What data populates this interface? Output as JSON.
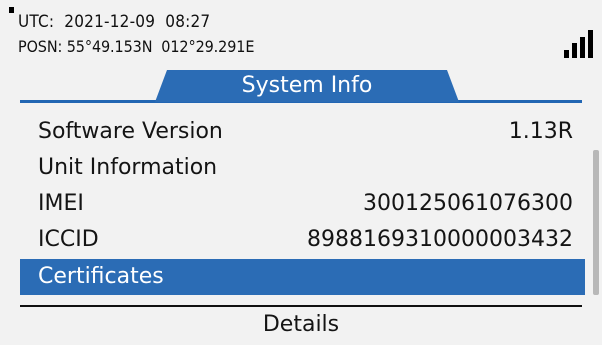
{
  "status": {
    "utc_text": "UTC:  2021-12-09  08:27",
    "posn_text": "POSN: 55°49.153N  012°29.291E",
    "signal_icon": "signal-strength-icon"
  },
  "tab": {
    "title": "System Info"
  },
  "list": {
    "items": [
      {
        "label": "Software Version",
        "value": "1.13R"
      },
      {
        "label": "Unit Information",
        "value": ""
      },
      {
        "label": "IMEI",
        "value": "300125061076300"
      },
      {
        "label": "ICCID",
        "value": "8988169310000003432"
      },
      {
        "label": "Certificates",
        "value": ""
      }
    ],
    "selected_index": 4
  },
  "footer": {
    "softkey_label": "Details"
  },
  "colors": {
    "accent": "#2b6cb5",
    "background": "#f2f2f2",
    "text": "#141414"
  }
}
